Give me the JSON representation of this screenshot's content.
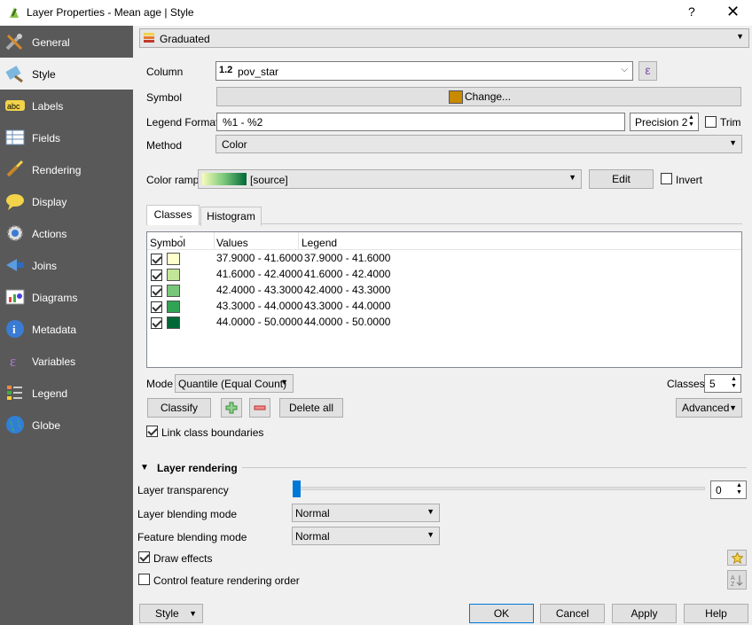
{
  "window": {
    "title": "Layer Properties - Mean age | Style",
    "help_glyph": "?",
    "close_glyph": "✕"
  },
  "sidebar": {
    "items": [
      {
        "label": "General",
        "icon": "tools-icon"
      },
      {
        "label": "Style",
        "icon": "paintbrush-icon"
      },
      {
        "label": "Labels",
        "icon": "abc-labels-icon"
      },
      {
        "label": "Fields",
        "icon": "table-fields-icon"
      },
      {
        "label": "Rendering",
        "icon": "brush-rendering-icon"
      },
      {
        "label": "Display",
        "icon": "speech-bubble-icon"
      },
      {
        "label": "Actions",
        "icon": "gear-actions-icon"
      },
      {
        "label": "Joins",
        "icon": "joins-icon"
      },
      {
        "label": "Diagrams",
        "icon": "diagram-icon"
      },
      {
        "label": "Metadata",
        "icon": "info-icon"
      },
      {
        "label": "Variables",
        "icon": "epsilon-icon"
      },
      {
        "label": "Legend",
        "icon": "legend-icon"
      },
      {
        "label": "Globe",
        "icon": "globe-icon"
      }
    ]
  },
  "renderer": {
    "type": "Graduated"
  },
  "form": {
    "column_label": "Column",
    "column_type": "1.2",
    "column_value": "pov_star",
    "expr_glyph": "ε",
    "symbol_label": "Symbol",
    "symbol_button": "Change...",
    "symbol_color": "#c98a00",
    "legend_format_label": "Legend Format",
    "legend_format_value": "%1 - %2",
    "precision_label": "Precision 2",
    "trim_label": "Trim",
    "method_label": "Method",
    "method_value": "Color",
    "color_ramp_label": "Color ramp",
    "color_ramp_value": "[source]",
    "edit_button": "Edit",
    "invert_label": "Invert"
  },
  "tabs": {
    "classes": "Classes",
    "histogram": "Histogram"
  },
  "table": {
    "headers": {
      "symbol": "Symbol",
      "values": "Values",
      "legend": "Legend"
    },
    "rows": [
      {
        "values": "37.9000 - 41.6000",
        "legend": "37.9000 - 41.6000",
        "color": "#ffffcc"
      },
      {
        "values": "41.6000 - 42.4000",
        "legend": "41.6000 - 42.4000",
        "color": "#c2e699"
      },
      {
        "values": "42.4000 - 43.3000",
        "legend": "42.4000 - 43.3000",
        "color": "#78c679"
      },
      {
        "values": "43.3000 - 44.0000",
        "legend": "43.3000 - 44.0000",
        "color": "#31a354"
      },
      {
        "values": "44.0000 - 50.0000",
        "legend": "44.0000 - 50.0000",
        "color": "#006837"
      }
    ]
  },
  "classify": {
    "mode_label": "Mode",
    "mode_value": "Quantile (Equal Count)",
    "classes_label": "Classes",
    "classes_value": "5",
    "classify_button": "Classify",
    "delete_all_button": "Delete all",
    "advanced_button": "Advanced",
    "link_boundaries_label": "Link class boundaries"
  },
  "layer_rendering": {
    "section_title": "Layer rendering",
    "transparency_label": "Layer transparency",
    "transparency_value": "0",
    "blending_label": "Layer blending mode",
    "blending_value": "Normal",
    "feature_blending_label": "Feature blending mode",
    "feature_blending_value": "Normal",
    "draw_effects_label": "Draw effects",
    "control_order_label": "Control feature rendering order"
  },
  "footer": {
    "style": "Style",
    "ok": "OK",
    "cancel": "Cancel",
    "apply": "Apply",
    "help": "Help"
  },
  "colors": {
    "sidebar_bg": "#595959",
    "ramp_start": "#f7fcb9",
    "ramp_end": "#006837",
    "accent": "#0078d7"
  }
}
